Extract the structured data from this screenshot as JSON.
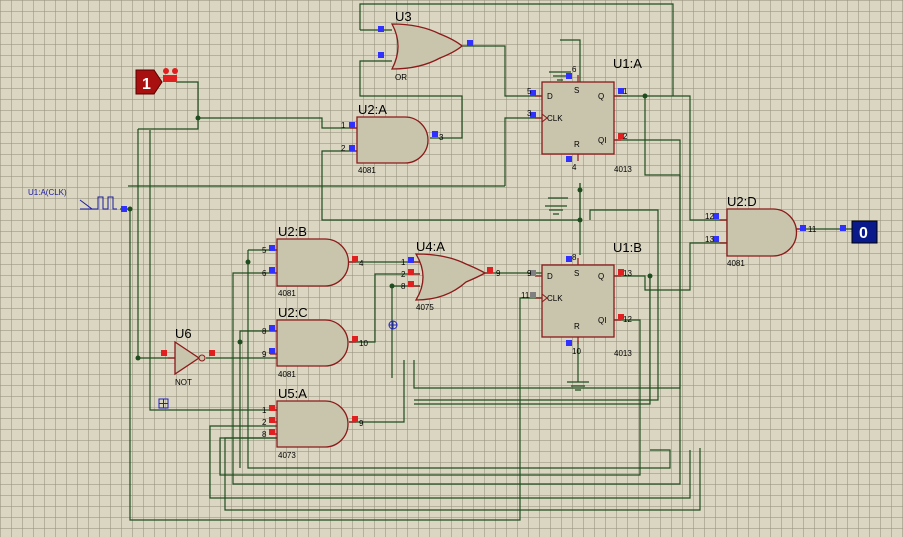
{
  "colors": {
    "background": "#dbd6c1",
    "wire": "#1f4d1f",
    "component_outline": "#8b1a1a",
    "component_fill": "#c9c4ac",
    "pin_high": "#e02020",
    "pin_low": "#3030ff",
    "input_fill": "#a81010",
    "output_fill": "#0a1a8a"
  },
  "input": {
    "state": "1"
  },
  "output": {
    "state": "0"
  },
  "clock": {
    "label": "U1:A(CLK)"
  },
  "components": {
    "u3": {
      "ref": "U3",
      "type": "OR"
    },
    "u2a": {
      "ref": "U2:A",
      "type": "4081",
      "pins": {
        "p1": "1",
        "p2": "2",
        "p3": "3"
      }
    },
    "u1a": {
      "ref": "U1:A",
      "type": "4013",
      "labels": {
        "d": "D",
        "s": "S",
        "q": "Q",
        "clk": "CLK",
        "r": "R",
        "qi": "QI"
      },
      "pins": {
        "p5": "5",
        "p3": "3",
        "p1": "1",
        "p2": "2",
        "p6": "6",
        "p4": "4"
      }
    },
    "u2d": {
      "ref": "U2:D",
      "type": "4081",
      "pins": {
        "p12": "12",
        "p13": "13",
        "p11": "11"
      }
    },
    "u2b": {
      "ref": "U2:B",
      "type": "4081",
      "pins": {
        "p5": "5",
        "p6": "6",
        "p4": "4"
      }
    },
    "u4a": {
      "ref": "U4:A",
      "type": "4075",
      "pins": {
        "p1": "1",
        "p2": "2",
        "p8": "8",
        "p9": "9"
      }
    },
    "u1b": {
      "ref": "U1:B",
      "type": "4013",
      "labels": {
        "d": "D",
        "s": "S",
        "q": "Q",
        "clk": "CLK",
        "r": "R",
        "qi": "QI"
      },
      "pins": {
        "p9": "9",
        "p11": "11",
        "p13": "13",
        "p12": "12",
        "p8": "8",
        "p10": "10"
      }
    },
    "u6": {
      "ref": "U6",
      "type": "NOT"
    },
    "u2c": {
      "ref": "U2:C",
      "type": "4081",
      "pins": {
        "p8": "8",
        "p9": "9",
        "p10": "10"
      }
    },
    "u5a": {
      "ref": "U5:A",
      "type": "4073",
      "pins": {
        "p1": "1",
        "p2": "2",
        "p8": "8",
        "p9": "9"
      }
    }
  }
}
